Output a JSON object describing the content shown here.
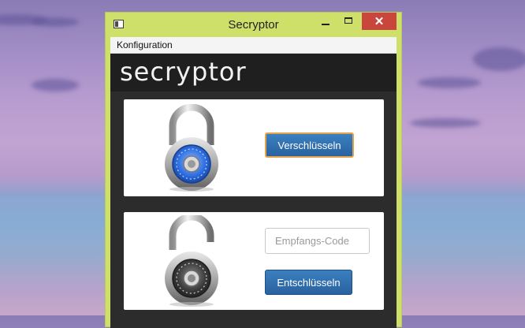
{
  "window": {
    "title": "Secryptor",
    "close_symbol": "✕"
  },
  "menu": {
    "items": [
      "Konfiguration"
    ]
  },
  "banner": {
    "logo_text": "secryptor"
  },
  "encrypt_panel": {
    "icon": "padlock-closed-blue-icon",
    "button_label": "Verschlüsseln"
  },
  "decrypt_panel": {
    "icon": "padlock-open-dark-icon",
    "code_placeholder": "Empfangs-Code",
    "code_value": "",
    "button_label": "Entschlüsseln"
  },
  "colors": {
    "window_frame": "#cfe06a",
    "close_button": "#c9463d",
    "button_blue": "#2f6fae",
    "focus_ring": "#e6a24a",
    "dark_background": "#2c2c2c"
  }
}
